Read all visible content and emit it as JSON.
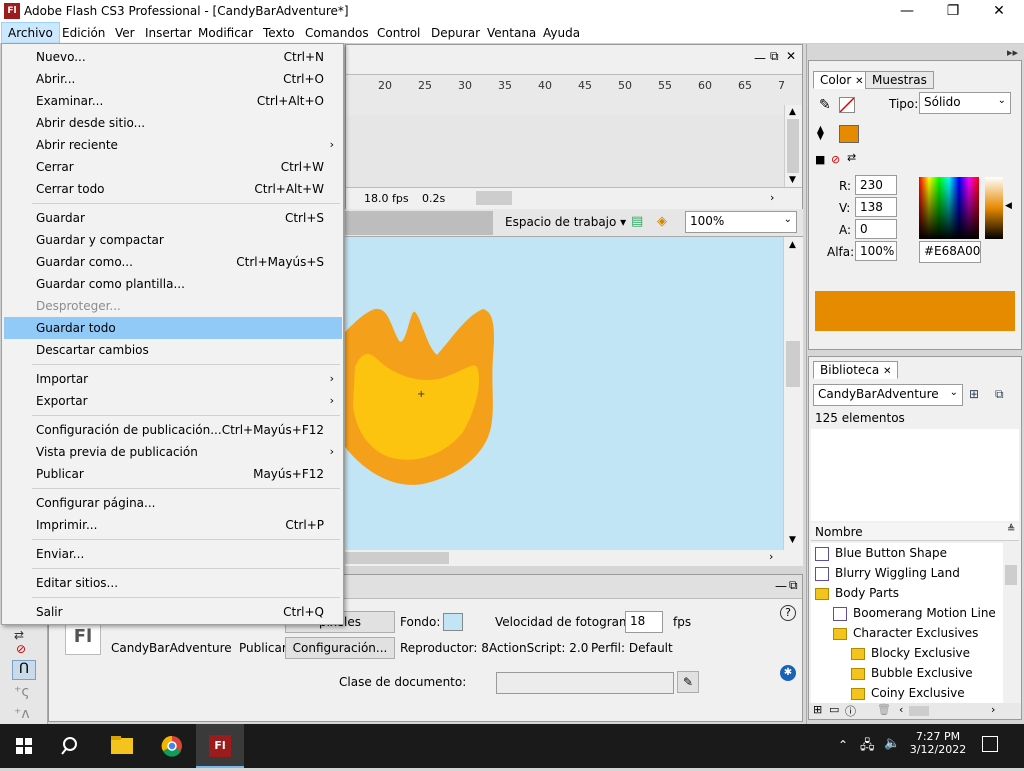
{
  "window": {
    "title": "Adobe Flash CS3 Professional - [CandyBarAdventure*]",
    "logo": "Fl",
    "minimize": "—",
    "maximize": "❐",
    "close": "✕"
  },
  "menubar": [
    "Archivo",
    "Edición",
    "Ver",
    "Insertar",
    "Modificar",
    "Texto",
    "Comandos",
    "Control",
    "Depurar",
    "Ventana",
    "Ayuda"
  ],
  "file_menu": {
    "groups": [
      [
        {
          "label": "Nuevo...",
          "shortcut": "Ctrl+N"
        },
        {
          "label": "Abrir...",
          "shortcut": "Ctrl+O"
        },
        {
          "label": "Examinar...",
          "shortcut": "Ctrl+Alt+O"
        },
        {
          "label": "Abrir desde sitio...",
          "shortcut": ""
        },
        {
          "label": "Abrir reciente",
          "shortcut": "",
          "submenu": true
        },
        {
          "label": "Cerrar",
          "shortcut": "Ctrl+W"
        },
        {
          "label": "Cerrar todo",
          "shortcut": "Ctrl+Alt+W"
        }
      ],
      [
        {
          "label": "Guardar",
          "shortcut": "Ctrl+S"
        },
        {
          "label": "Guardar y compactar",
          "shortcut": ""
        },
        {
          "label": "Guardar como...",
          "shortcut": "Ctrl+Mayús+S"
        },
        {
          "label": "Guardar como plantilla...",
          "shortcut": ""
        },
        {
          "label": "Desproteger...",
          "shortcut": "",
          "disabled": true
        },
        {
          "label": "Guardar todo",
          "shortcut": "",
          "highlighted": true
        },
        {
          "label": "Descartar cambios",
          "shortcut": ""
        }
      ],
      [
        {
          "label": "Importar",
          "shortcut": "",
          "submenu": true
        },
        {
          "label": "Exportar",
          "shortcut": "",
          "submenu": true
        }
      ],
      [
        {
          "label": "Configuración de publicación...",
          "shortcut": "Ctrl+Mayús+F12"
        },
        {
          "label": "Vista previa de publicación",
          "shortcut": "",
          "submenu": true
        },
        {
          "label": "Publicar",
          "shortcut": "Mayús+F12"
        }
      ],
      [
        {
          "label": "Configurar página...",
          "shortcut": ""
        },
        {
          "label": "Imprimir...",
          "shortcut": "Ctrl+P"
        }
      ],
      [
        {
          "label": "Enviar...",
          "shortcut": ""
        }
      ],
      [
        {
          "label": "Editar sitios...",
          "shortcut": ""
        }
      ],
      [
        {
          "label": "Salir",
          "shortcut": "Ctrl+Q"
        }
      ]
    ]
  },
  "timeline": {
    "ruler": [
      "20",
      "25",
      "30",
      "35",
      "40",
      "45",
      "50",
      "55",
      "60",
      "65",
      "7"
    ],
    "fps": "18.0 fps",
    "time": "0.2s"
  },
  "editbar": {
    "workspace": "Espacio de trabajo",
    "zoom": "100%"
  },
  "properties": {
    "document_name": "CandyBarAdventure",
    "size_value": "píxeles",
    "fondo_label": "Fondo:",
    "fps_label": "Velocidad de fotogramas:",
    "fps_value": "18",
    "fps_unit": "fps",
    "publicar_label": "Publicar:",
    "config_button": "Configuración...",
    "reproductor": "Reproductor: 8",
    "actionscript": "ActionScript: 2.0",
    "perfil": "Perfil: Default",
    "clase_label": "Clase de documento:",
    "help": "?"
  },
  "color_panel": {
    "tab_color": "Color",
    "tab_muestras": "Muestras",
    "tipo_label": "Tipo:",
    "tipo_value": "Sólido",
    "r_label": "R:",
    "r_value": "230",
    "v_label": "V:",
    "v_value": "138",
    "a_label": "A:",
    "a_value": "0",
    "alfa_label": "Alfa:",
    "alfa_value": "100%",
    "hex_value": "#E68A00",
    "swatch_color": "#E68A00"
  },
  "library": {
    "tab": "Biblioteca",
    "document": "CandyBarAdventure",
    "count": "125 elementos",
    "column": "Nombre",
    "items": [
      {
        "label": "Blue Button Shape",
        "type": "symbol",
        "indent": 0
      },
      {
        "label": "Blurry Wiggling Land",
        "type": "symbol",
        "indent": 0
      },
      {
        "label": "Body Parts",
        "type": "folder",
        "indent": 0
      },
      {
        "label": "Boomerang Motion Line",
        "type": "symbol",
        "indent": 1
      },
      {
        "label": "Character Exclusives",
        "type": "folder",
        "indent": 1
      },
      {
        "label": "Blocky Exclusive",
        "type": "folder",
        "indent": 2
      },
      {
        "label": "Bubble Exclusive",
        "type": "folder",
        "indent": 2
      },
      {
        "label": "Coiny Exclusive",
        "type": "folder",
        "indent": 2
      }
    ]
  },
  "taskbar": {
    "time": "7:27 PM",
    "date": "3/12/2022",
    "flash_label": "Fl"
  }
}
